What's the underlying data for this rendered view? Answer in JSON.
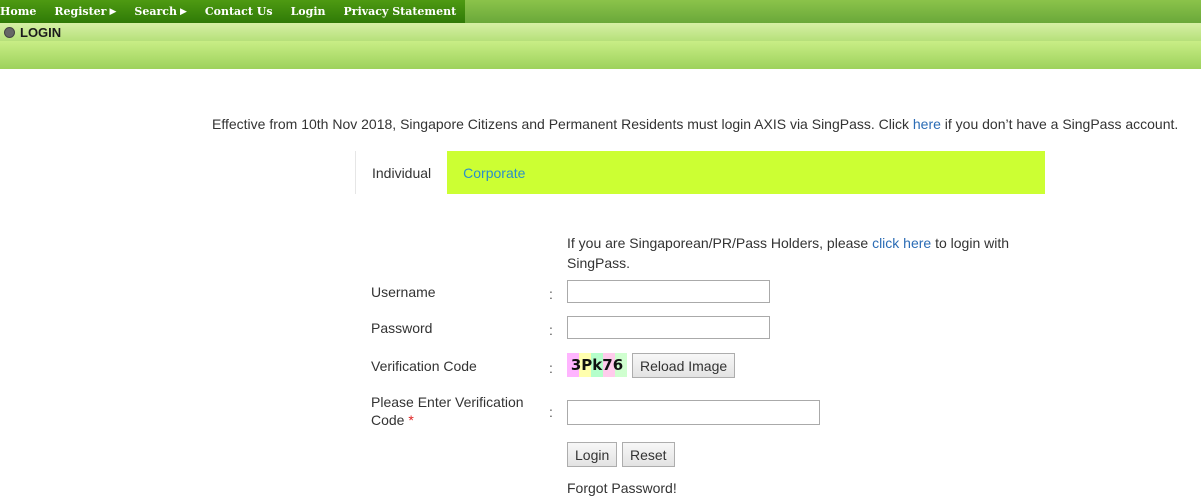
{
  "nav": {
    "home": "Home",
    "register": "Register",
    "search": "Search",
    "contact": "Contact Us",
    "login": "Login",
    "privacy": "Privacy Statement"
  },
  "header": {
    "title": "LOGIN"
  },
  "notice": {
    "before": "Effective from 10th Nov 2018, Singapore Citizens and Permanent Residents must login AXIS via SingPass. Click ",
    "link": "here",
    "after": " if you don’t have a SingPass account."
  },
  "tabs": {
    "individual": "Individual",
    "corporate": "Corporate"
  },
  "singpass": {
    "before": "If you are Singaporean/PR/Pass Holders, please ",
    "link": "click here",
    "after": " to login with",
    "line2": "SingPass."
  },
  "form": {
    "username_label": "Username",
    "password_label": "Password",
    "verification_label": "Verification Code",
    "captcha_text": "3Pk76",
    "reload_label": "Reload Image",
    "enter_code_label_1": "Please Enter Verification",
    "enter_code_label_2": "Code",
    "required_mark": "*",
    "colon": ":",
    "login_label": "Login",
    "reset_label": "Reset",
    "forgot_label": "Forgot Password!"
  },
  "colors": {
    "nav_green": "#2f7a07",
    "tab_lime": "#ccff33",
    "link_blue": "#2b6cb5"
  }
}
